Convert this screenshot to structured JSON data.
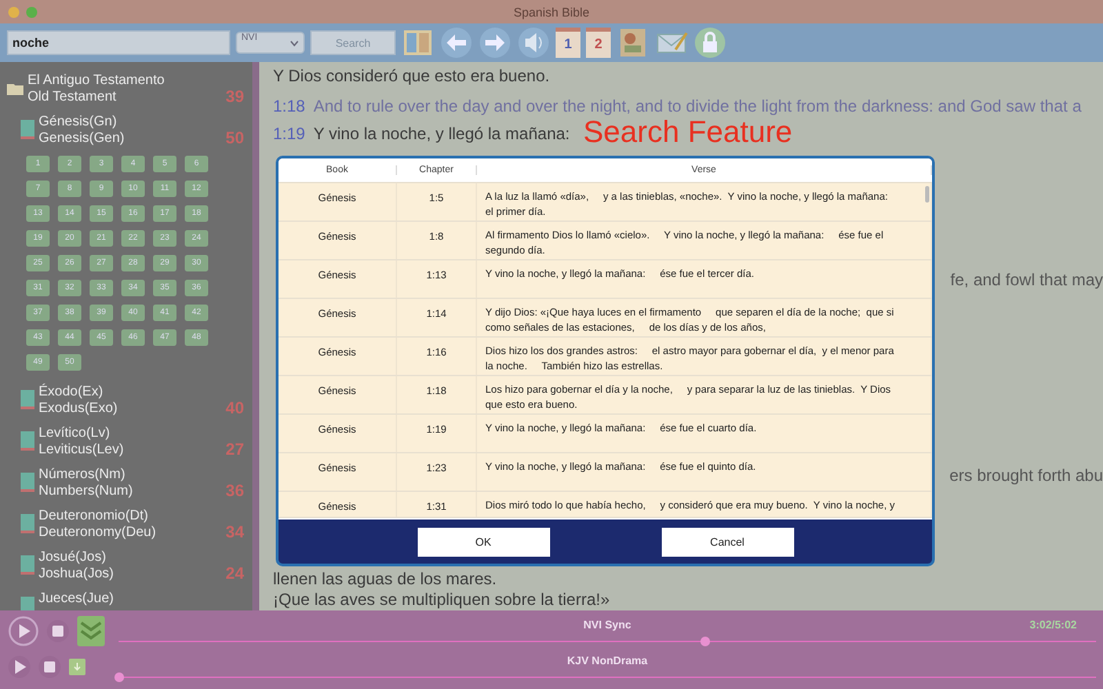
{
  "window": {
    "title": "Spanish Bible"
  },
  "toolbar": {
    "search_value": "noche",
    "version": "NVI",
    "search_button": "Search",
    "buttons": [
      {
        "kind": "map"
      },
      {
        "kind": "back"
      },
      {
        "kind": "forward"
      },
      {
        "kind": "speaker"
      },
      {
        "kind": "page",
        "label": "1"
      },
      {
        "kind": "page",
        "label": "2"
      },
      {
        "kind": "picture"
      },
      {
        "kind": "mail"
      },
      {
        "kind": "lock"
      }
    ]
  },
  "sidebar": {
    "testament": {
      "es": "El Antiguo Testamento",
      "en": "Old Testament",
      "count": "39"
    },
    "books": [
      {
        "es": "Génesis(Gn)",
        "en": "Genesis(Gen)",
        "count": "50",
        "chapters": [
          "1",
          "2",
          "3",
          "4",
          "5",
          "6",
          "7",
          "8",
          "9",
          "10",
          "11",
          "12",
          "13",
          "14",
          "15",
          "16",
          "17",
          "18",
          "19",
          "20",
          "21",
          "22",
          "23",
          "24",
          "25",
          "26",
          "27",
          "28",
          "29",
          "30",
          "31",
          "32",
          "33",
          "34",
          "35",
          "36",
          "37",
          "38",
          "39",
          "40",
          "41",
          "42",
          "43",
          "44",
          "45",
          "46",
          "47",
          "48",
          "49",
          "50"
        ]
      },
      {
        "es": "Éxodo(Ex)",
        "en": "Exodus(Exo)",
        "count": "40"
      },
      {
        "es": "Levítico(Lv)",
        "en": "Leviticus(Lev)",
        "count": "27"
      },
      {
        "es": "Números(Nm)",
        "en": "Numbers(Num)",
        "count": "36"
      },
      {
        "es": "Deuteronomio(Dt)",
        "en": "Deuteronomy(Deu)",
        "count": "34"
      },
      {
        "es": "Josué(Jos)",
        "en": "Joshua(Jos)",
        "count": "24"
      },
      {
        "es": "Jueces(Jue)"
      }
    ]
  },
  "reading": {
    "top": [
      {
        "text": "Y Dios consideró que esto era bueno."
      },
      {
        "verse": "1:18",
        "text": "And to rule over the day and over the night, and to divide the light from the darkness: and God saw that a",
        "kind": "english"
      },
      {
        "verse": "1:19",
        "text": "Y vino la noche, y llegó la mañana:",
        "kind": "spanish"
      }
    ],
    "side_fragments": [
      "fe, and fowl that may",
      "ers brought forth abu"
    ],
    "bottom": [
      "llenen las aguas de los mares.",
      "¡Que las aves se multipliquen sobre la tierra!»"
    ],
    "overlay_caption": "Search Feature"
  },
  "dialog": {
    "columns": [
      "Book",
      "Chapter",
      "Verse"
    ],
    "rows": [
      [
        "Génesis",
        "1:5",
        "A la luz la llamó «día»,     y a las tinieblas, «noche».  Y vino la noche, y llegó la mañana:\nel primer día."
      ],
      [
        "Génesis",
        "1:8",
        "Al firmamento Dios lo llamó «cielo».     Y vino la noche, y llegó la mañana:     ése fue el\nsegundo día."
      ],
      [
        "Génesis",
        "1:13",
        "Y vino la noche, y llegó la mañana:     ése fue el tercer día."
      ],
      [
        "Génesis",
        "1:14",
        "Y dijo Dios: «¡Que haya luces en el firmamento     que separen el día de la noche;  que si\ncomo señales de las estaciones,     de los días y de los años,"
      ],
      [
        "Génesis",
        "1:16",
        "Dios hizo los dos grandes astros:     el astro mayor para gobernar el día,  y el menor para\nla noche.     También hizo las estrellas."
      ],
      [
        "Génesis",
        "1:18",
        "Los hizo para gobernar el día y la noche,     y para separar la luz de las tinieblas.  Y Dios\nque esto era bueno."
      ],
      [
        "Génesis",
        "1:19",
        "Y vino la noche, y llegó la mañana:     ése fue el cuarto día."
      ],
      [
        "Génesis",
        "1:23",
        "Y vino la noche, y llegó la mañana:     ése fue el quinto día."
      ],
      [
        "Génesis",
        "1:31",
        "Dios miró todo lo que había hecho,     y consideró que era muy bueno.  Y vino la noche, y"
      ]
    ],
    "buttons": [
      "OK",
      "Cancel"
    ]
  },
  "player": {
    "tracks": [
      {
        "name": "NVI Sync",
        "time": "3:02/5:02",
        "level": 0.6,
        "kind": "large"
      },
      {
        "name": "KJV NonDrama",
        "level": 0,
        "kind": "small"
      }
    ]
  }
}
